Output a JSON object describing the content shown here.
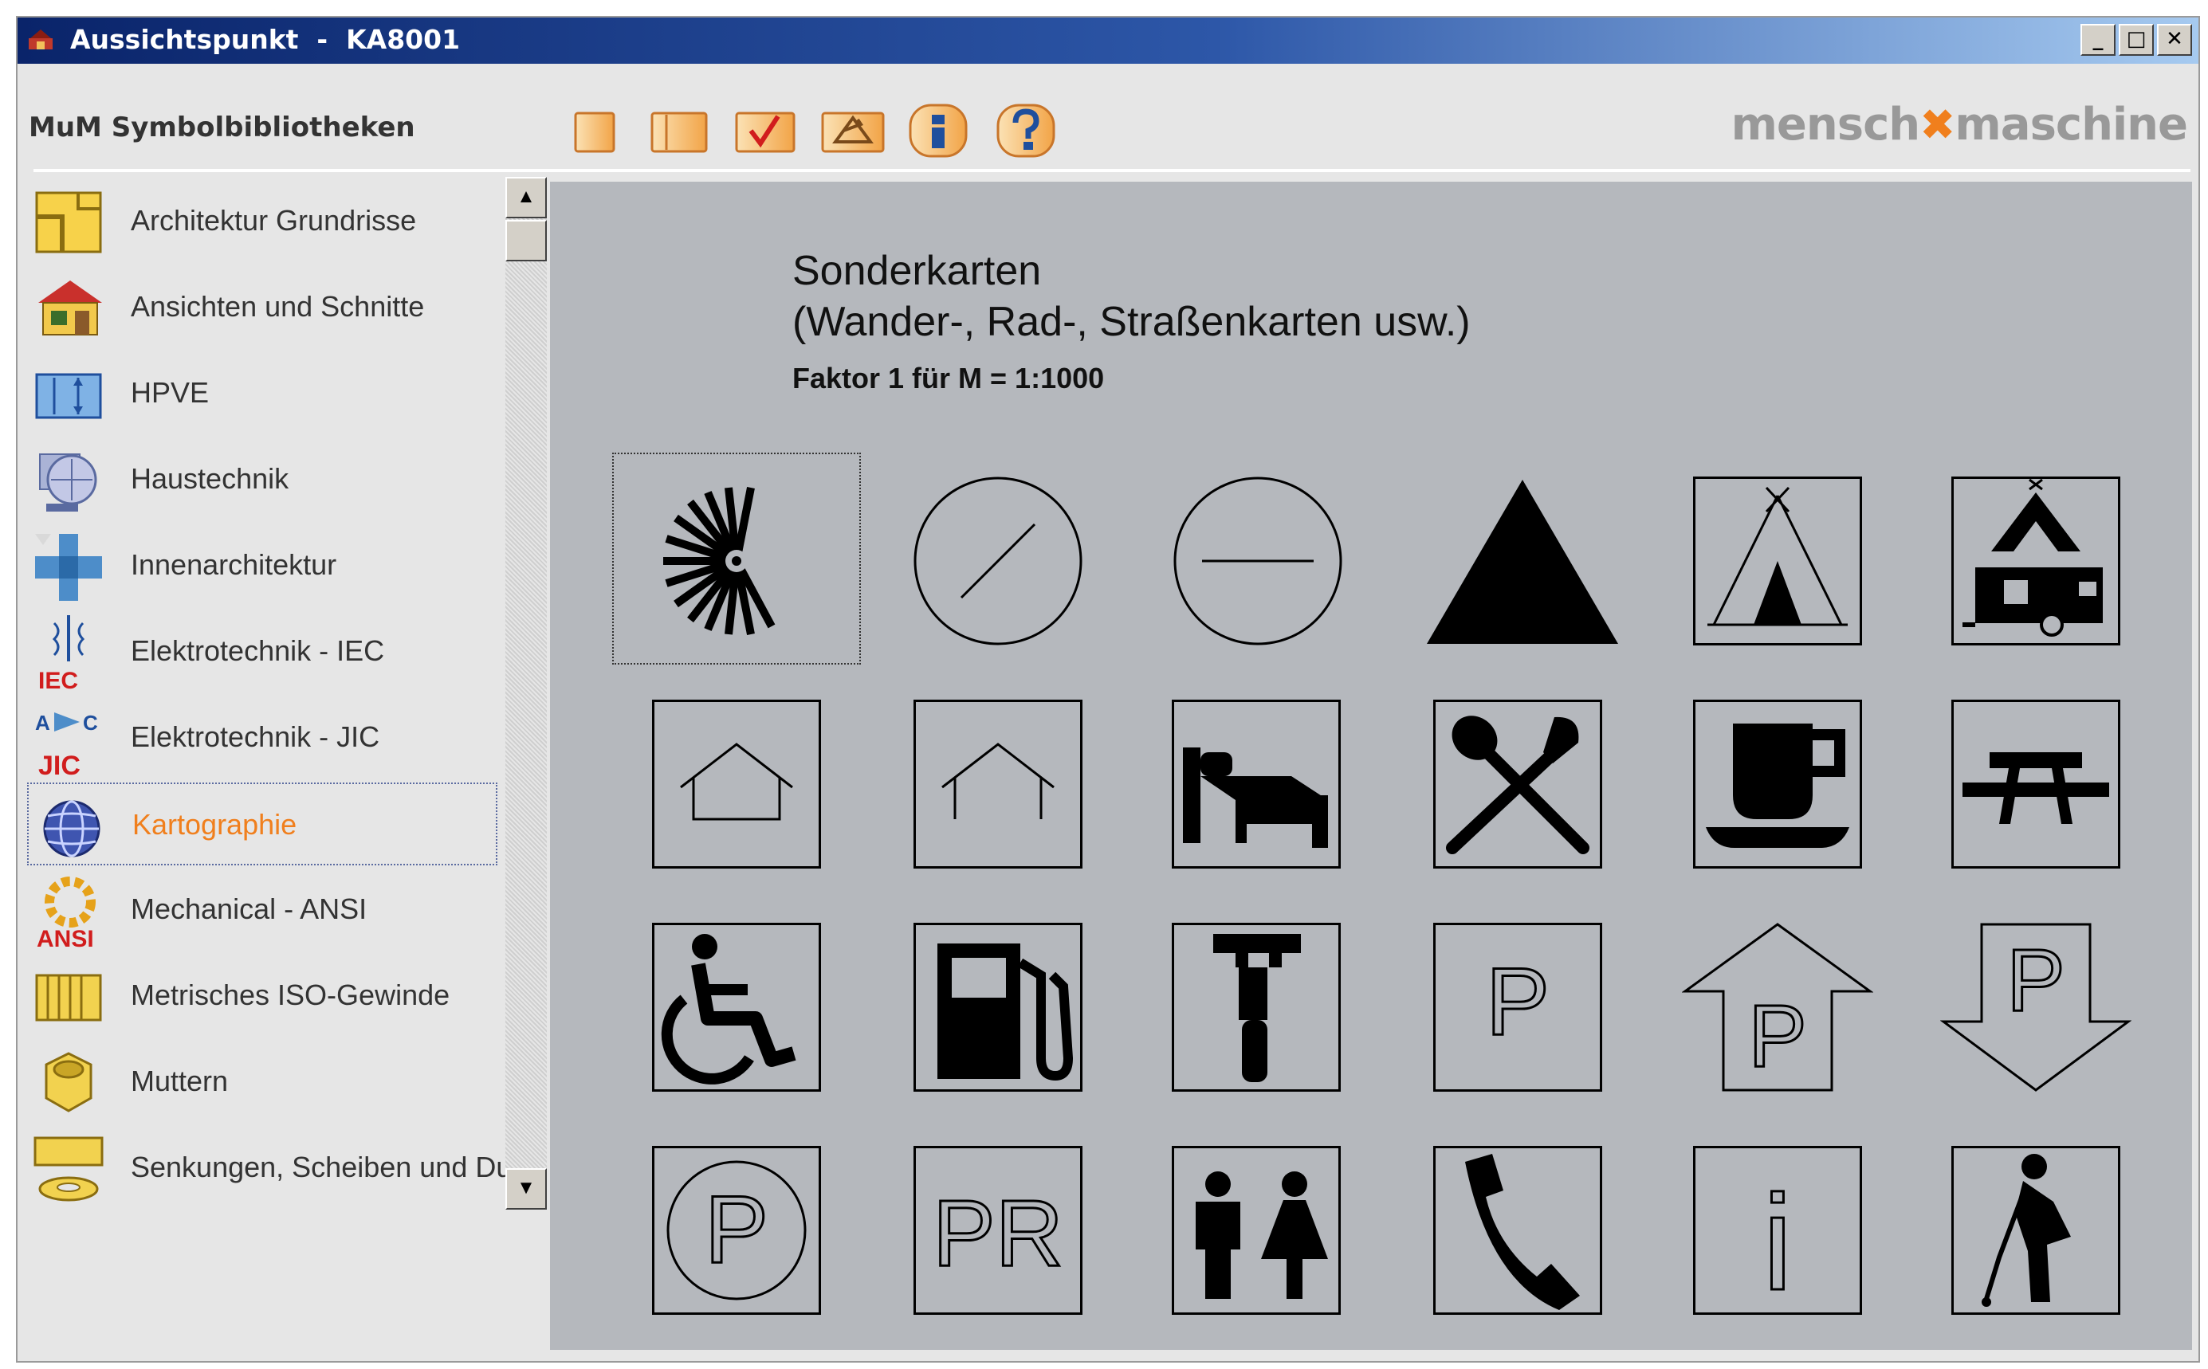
{
  "window": {
    "title": "Aussichtspunkt  -  KA8001",
    "minimize": "_",
    "maximize": "□",
    "close": "✕"
  },
  "app": {
    "title": "MuM Symbolbibliotheken",
    "brand_left": "mensch",
    "brand_right": "maschine"
  },
  "toolbar": {
    "buttons": [
      "new-icon",
      "open-icon",
      "check-icon",
      "insert-icon",
      "info-icon",
      "help-icon"
    ]
  },
  "sidebar": {
    "items": [
      {
        "label": "Architektur Grundrisse",
        "icon": "floorplan-icon"
      },
      {
        "label": "Ansichten und Schnitte",
        "icon": "house-icon"
      },
      {
        "label": "HPVE",
        "icon": "hpve-icon"
      },
      {
        "label": "Haustechnik",
        "icon": "haustechnik-icon"
      },
      {
        "label": "Innenarchitektur",
        "icon": "furniture-icon"
      },
      {
        "label": "Elektrotechnik - IEC",
        "icon": "iec-icon",
        "tag": "IEC"
      },
      {
        "label": "Elektrotechnik - JIC",
        "icon": "jic-icon",
        "tag": "JIC"
      },
      {
        "label": "Kartographie",
        "icon": "globe-icon",
        "active": true
      },
      {
        "label": "Mechanical - ANSI",
        "icon": "gear-icon",
        "tag": "ANSI"
      },
      {
        "label": "Metrisches ISO-Gewinde",
        "icon": "thread-icon"
      },
      {
        "label": "Muttern",
        "icon": "nut-icon"
      },
      {
        "label": "Senkungen, Scheiben und Du",
        "icon": "washer-icon"
      }
    ]
  },
  "main": {
    "heading_line1": "Sonderkarten",
    "heading_line2": "(Wander-, Rad-, Straßenkarten usw.)",
    "factor": "Faktor 1 für M = 1:1000",
    "symbols": [
      "viewpoint-symbol",
      "circle-slash-symbol",
      "circle-minus-symbol",
      "triangle-symbol",
      "tent-symbol",
      "caravan-symbol",
      "house-symbol",
      "shelter-symbol",
      "bed-symbol",
      "restaurant-symbol",
      "cafe-symbol",
      "picnic-symbol",
      "wheelchair-symbol",
      "fuel-symbol",
      "repair-symbol",
      "parking-symbol",
      "parking-up-symbol",
      "parking-down-symbol",
      "parking-circle-symbol",
      "park-and-ride-symbol",
      "toilets-symbol",
      "telephone-symbol",
      "information-symbol",
      "golf-symbol"
    ],
    "labels": {
      "p": "P",
      "pr": "PR",
      "i": "i"
    }
  }
}
